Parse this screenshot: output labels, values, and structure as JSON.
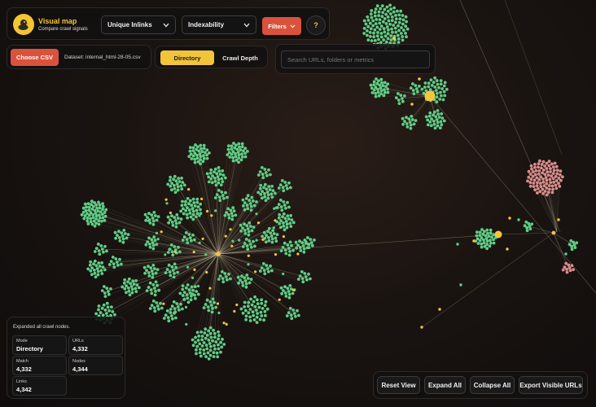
{
  "app": {
    "title": "Visual map",
    "subtitle": "Compare crawl signals",
    "logo_icon": "duck-logo-icon"
  },
  "toolbar": {
    "metric_select": "Unique Inlinks",
    "category_select": "Indexability",
    "filters_label": "Filters",
    "help_label": "?",
    "choose_csv_label": "Choose CSV",
    "dataset_label": "Dataset: internal_html-28-05.csv",
    "mode_tabs": [
      {
        "label": "Directory",
        "active": true
      },
      {
        "label": "Crawl Depth",
        "active": false
      }
    ],
    "search_placeholder": "Search URLs, folders or metrics"
  },
  "status_panel": {
    "message": "Expanded all crawl nodes.",
    "stats": [
      {
        "label": "Mode",
        "value": "Directory"
      },
      {
        "label": "URLs",
        "value": "4,332"
      },
      {
        "label": "Match",
        "value": "4,332"
      },
      {
        "label": "Nodes",
        "value": "4,344"
      },
      {
        "label": "Links",
        "value": "4,342"
      }
    ]
  },
  "actions": {
    "reset_view": "Reset View",
    "expand_all": "Expand All",
    "collapse_all": "Collapse All",
    "export_visible": "Export Visible URLs"
  },
  "colors": {
    "accent_orange": "#d9533c",
    "accent_yellow": "#f2c43a",
    "node_green": "#5fce86",
    "node_pink": "#d98c8c",
    "hub_yellow": "#f5c542",
    "background": "#151111"
  }
}
